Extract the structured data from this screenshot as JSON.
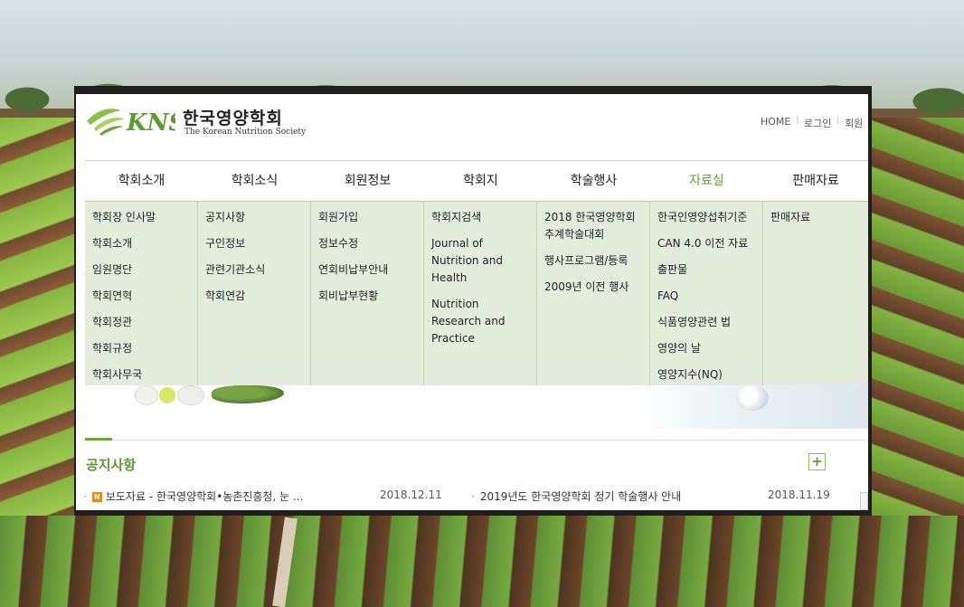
{
  "header": {
    "logo_mark": "KNS",
    "logo_kr": "한국영양학회",
    "logo_en": "The Korean Nutrition Society",
    "utils": [
      "HOME",
      "로그인",
      "회원"
    ]
  },
  "gnb": {
    "items": [
      {
        "label": "학회소개",
        "active": false
      },
      {
        "label": "학회소식",
        "active": false
      },
      {
        "label": "회원정보",
        "active": false
      },
      {
        "label": "학회지",
        "active": false
      },
      {
        "label": "학술행사",
        "active": false
      },
      {
        "label": "자료실",
        "active": true
      },
      {
        "label": "판매자료",
        "active": false
      }
    ],
    "active_color": "#6a9e32"
  },
  "dropdown": {
    "columns": [
      [
        "학회장 인사말",
        "학회소개",
        "임원명단",
        "학회연혁",
        "학회정관",
        "학회규정",
        "학회사무국"
      ],
      [
        "공지사항",
        "구인정보",
        "관련기관소식",
        "학회연감"
      ],
      [
        "회원가입",
        "정보수정",
        "연회비납부안내",
        "회비납부현황"
      ],
      [
        "학회지검색",
        "Journal of Nutrition and Health",
        "Nutrition Research and Practice"
      ],
      [
        "2018 한국영양학회 추계학술대회",
        "행사프로그램/등록",
        "2009년 이전 행사"
      ],
      [
        "한국인영양섭취기준",
        "CAN 4.0 이전 자료",
        "출판물",
        "FAQ",
        "식품영양관련 법",
        "영양의 날",
        "영양지수(NQ)"
      ],
      [
        "판매자료"
      ]
    ]
  },
  "notice": {
    "title": "공지사항",
    "more_label": "+",
    "items": [
      {
        "badge": "N",
        "text": "보도자료 - 한국영양학회•농촌진흥청, 눈 ...",
        "date": "2018.12.11"
      },
      {
        "badge": "",
        "text": "2019년도 한국영양학회 정기 학술행사 안내",
        "date": "2018.11.19"
      }
    ]
  },
  "colors": {
    "accent_green": "#6aa838",
    "dropdown_bg": "#e4eddb",
    "window_frame": "#1e1e1e"
  }
}
